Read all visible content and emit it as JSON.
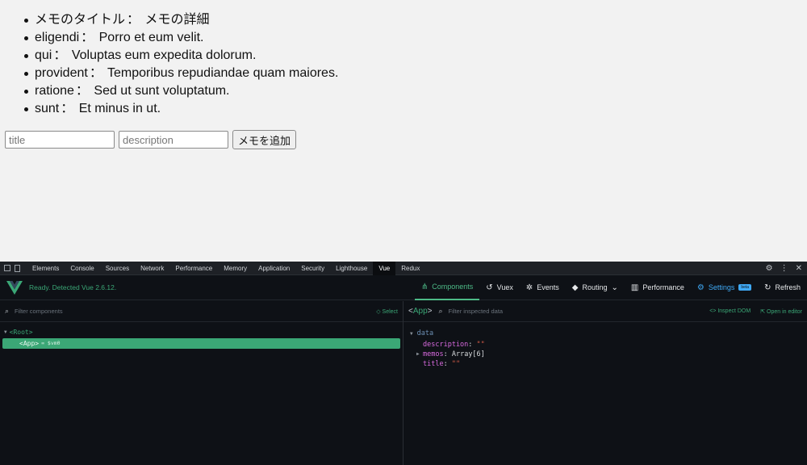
{
  "memos": [
    {
      "title": "メモのタイトル",
      "sep": "：",
      "detail": "メモの詳細"
    },
    {
      "title": "eligendi",
      "sep": "：",
      "detail": "Porro et eum velit."
    },
    {
      "title": "qui",
      "sep": "：",
      "detail": "Voluptas eum expedita dolorum."
    },
    {
      "title": "provident",
      "sep": "：",
      "detail": "Temporibus repudiandae quam maiores."
    },
    {
      "title": "ratione",
      "sep": "：",
      "detail": "Sed ut sunt voluptatum."
    },
    {
      "title": "sunt",
      "sep": "：",
      "detail": "Et minus in ut."
    }
  ],
  "form": {
    "title_placeholder": "title",
    "description_placeholder": "description",
    "add_button": "メモを追加"
  },
  "devtools": {
    "tabs": [
      "Elements",
      "Console",
      "Sources",
      "Network",
      "Performance",
      "Memory",
      "Application",
      "Security",
      "Lighthouse",
      "Vue",
      "Redux"
    ],
    "active_tab": "Vue",
    "trail_icons": [
      "gear-icon",
      "kebab-menu-icon",
      "close-icon"
    ]
  },
  "vue": {
    "status": "Ready. Detected Vue 2.6.12.",
    "nav": {
      "components": "Components",
      "vuex": "Vuex",
      "events": "Events",
      "routing": "Routing",
      "performance": "Performance",
      "settings": "Settings",
      "settings_badge": "beta",
      "refresh": "Refresh"
    },
    "colors": {
      "accent": "#3ba776",
      "settings": "#3fa9f5",
      "string": "#e0604a",
      "key": "#d86adf"
    }
  },
  "left_pane": {
    "filter_placeholder": "Filter components",
    "select_label": "Select",
    "tree": {
      "root": "Root",
      "app": "App",
      "app_suffix": "= $vm0"
    }
  },
  "right_pane": {
    "component_tag": "App",
    "filter_placeholder": "Filter inspected data",
    "inspect_dom": "Inspect DOM",
    "open_in_editor": "Open in editor",
    "section": "data",
    "props": [
      {
        "key": "description",
        "value": "\"\""
      },
      {
        "key": "memos",
        "value": "Array[6]"
      },
      {
        "key": "title",
        "value": "\"\""
      }
    ]
  }
}
